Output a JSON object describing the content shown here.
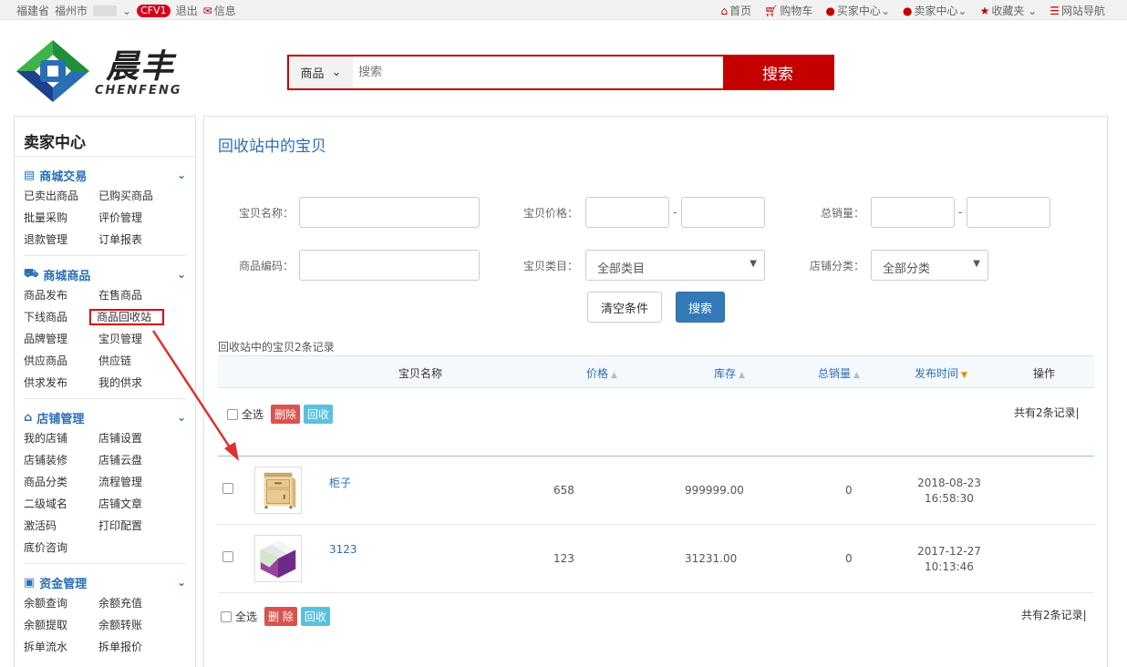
{
  "topbar": {
    "province": "福建省",
    "city": "福州市",
    "user_badge": "CFV1",
    "logout": "退出",
    "messages": "信息",
    "links": [
      "首页",
      "购物车",
      "买家中心",
      "卖家中心",
      "收藏夹",
      "网站导航"
    ]
  },
  "logo": {
    "cn": "晨丰",
    "en": "CHENFENG"
  },
  "search": {
    "category": "商品",
    "placeholder": "搜索",
    "button": "搜索"
  },
  "sidebar": {
    "title": "卖家中心",
    "sections": [
      {
        "title": "商城交易",
        "items": [
          "已卖出商品",
          "已购买商品",
          "批量采购",
          "评价管理",
          "退款管理",
          "订单报表"
        ]
      },
      {
        "title": "商城商品",
        "items": [
          "商品发布",
          "在售商品",
          "下线商品",
          "商品回收站",
          "品牌管理",
          "宝贝管理",
          "供应商品",
          "供应链",
          "供求发布",
          "我的供求"
        ]
      },
      {
        "title": "店铺管理",
        "items": [
          "我的店铺",
          "店铺设置",
          "店铺装修",
          "店铺云盘",
          "商品分类",
          "流程管理",
          "二级域名",
          "店铺文章",
          "激活码",
          "打印配置",
          "底价咨询"
        ]
      },
      {
        "title": "资金管理",
        "items": [
          "余额查询",
          "余额充值",
          "余额提取",
          "余额转账",
          "拆单流水",
          "拆单报价"
        ]
      }
    ]
  },
  "main": {
    "title": "回收站中的宝贝",
    "filters": {
      "name_label": "宝贝名称：",
      "price_label": "宝贝价格：",
      "sales_label": "总销量：",
      "code_label": "商品编码：",
      "category_label": "宝贝类目：",
      "category_value": "全部类目",
      "shopcat_label": "店铺分类：",
      "shopcat_value": "全部分类",
      "dash": "-",
      "clear_button": "清空条件",
      "search_button": "搜索"
    },
    "record_count": "回收站中的宝贝2条记录",
    "columns": {
      "name": "宝贝名称",
      "price": "价格",
      "stock": "库存",
      "sales": "总销量",
      "time": "发布时间",
      "action": "操作"
    },
    "bulk_top": {
      "select_all": "全选",
      "delete": "删除",
      "recover": "回收",
      "total": "共有2条记录|"
    },
    "rows": [
      {
        "name": "柜子",
        "price": "658",
        "stock": "999999.00",
        "sales": "0",
        "date": "2018-08-23",
        "time": "16:58:30",
        "thumb": "cabinet-thumbnail"
      },
      {
        "name": "3123",
        "price": "123",
        "stock": "31231.00",
        "sales": "0",
        "date": "2017-12-27",
        "time": "10:13:46",
        "thumb": "cube-thumbnail"
      }
    ],
    "bulk_bottom": {
      "select_all": "全选",
      "delete": "删 除",
      "recover": "回收",
      "total": "共有2条记录|"
    }
  },
  "colors": {
    "brand_red": "#c40000",
    "link_blue": "#2a6fb5",
    "primary_blue": "#337ab7",
    "danger": "#d9534f",
    "info": "#5bc0de"
  }
}
